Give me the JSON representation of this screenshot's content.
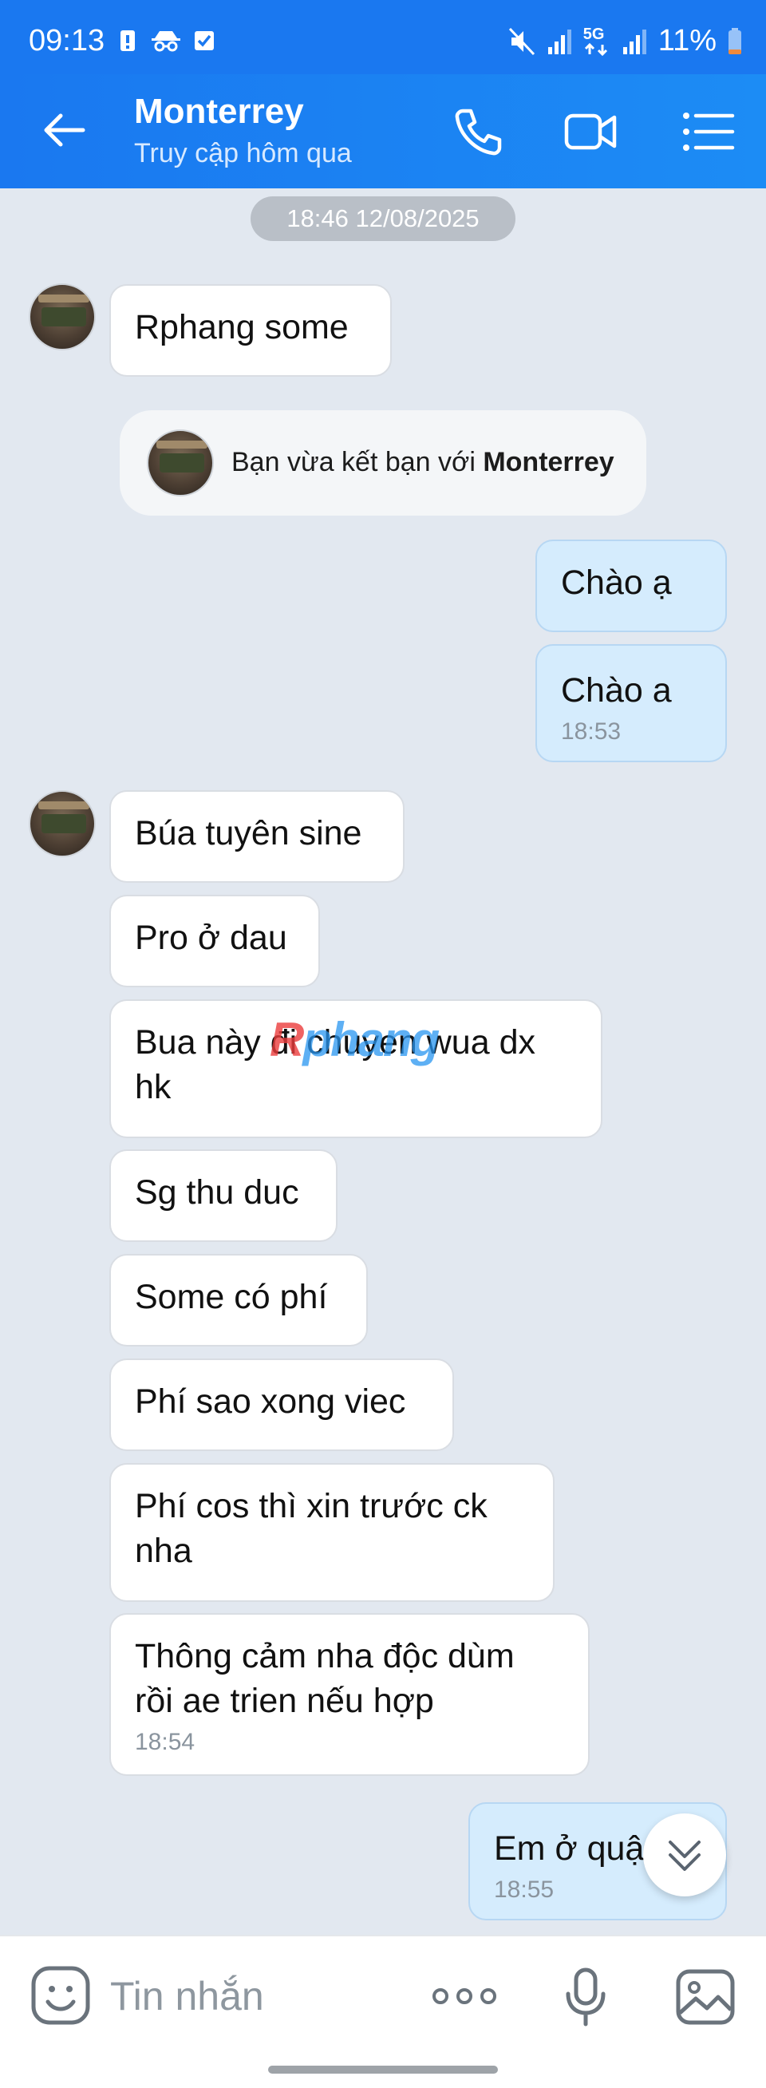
{
  "status_bar": {
    "time": "09:13",
    "network": "5G",
    "battery": "11%"
  },
  "header": {
    "title": "Monterrey",
    "subtitle": "Truy cập hôm qua"
  },
  "chat": {
    "date_separator": "18:46 12/08/2025",
    "messages": [
      {
        "dir": "in",
        "text": "Rphang some"
      },
      {
        "dir": "system",
        "text_prefix": "Bạn vừa kết bạn với",
        "text_name": "Monterrey"
      },
      {
        "dir": "out",
        "text": "Chào ạ"
      },
      {
        "dir": "out",
        "text": "Chào a",
        "time": "18:53"
      },
      {
        "dir": "in",
        "text": "Búa tuyên sine"
      },
      {
        "dir": "in",
        "text": "Pro ở dau"
      },
      {
        "dir": "in",
        "text_line1": "Bua này đi chuyen wua dx",
        "text_line2": "hk"
      },
      {
        "dir": "in",
        "text": "Sg thu duc"
      },
      {
        "dir": "in",
        "text": "Some có phí"
      },
      {
        "dir": "in",
        "text": "Phí sao xong viec"
      },
      {
        "dir": "in",
        "text_line1": "Phí cos thì xin trước ck",
        "text_line2": "nha"
      },
      {
        "dir": "in",
        "text_line1": "Thông cảm nha độc dùm",
        "text_line2": "rồi ae trien nếu hợp",
        "time": "18:54"
      },
      {
        "dir": "out",
        "text": "Em ở quậ",
        "time": "18:55"
      }
    ],
    "watermark_r": "R",
    "watermark_rest": "phang"
  },
  "composer": {
    "placeholder": "Tin nhắn"
  },
  "colors": {
    "header_blue": "#1a78f0",
    "outgoing_bubble": "#d5ecfd",
    "incoming_bubble": "#ffffff",
    "chat_bg": "#e2e8f0"
  }
}
